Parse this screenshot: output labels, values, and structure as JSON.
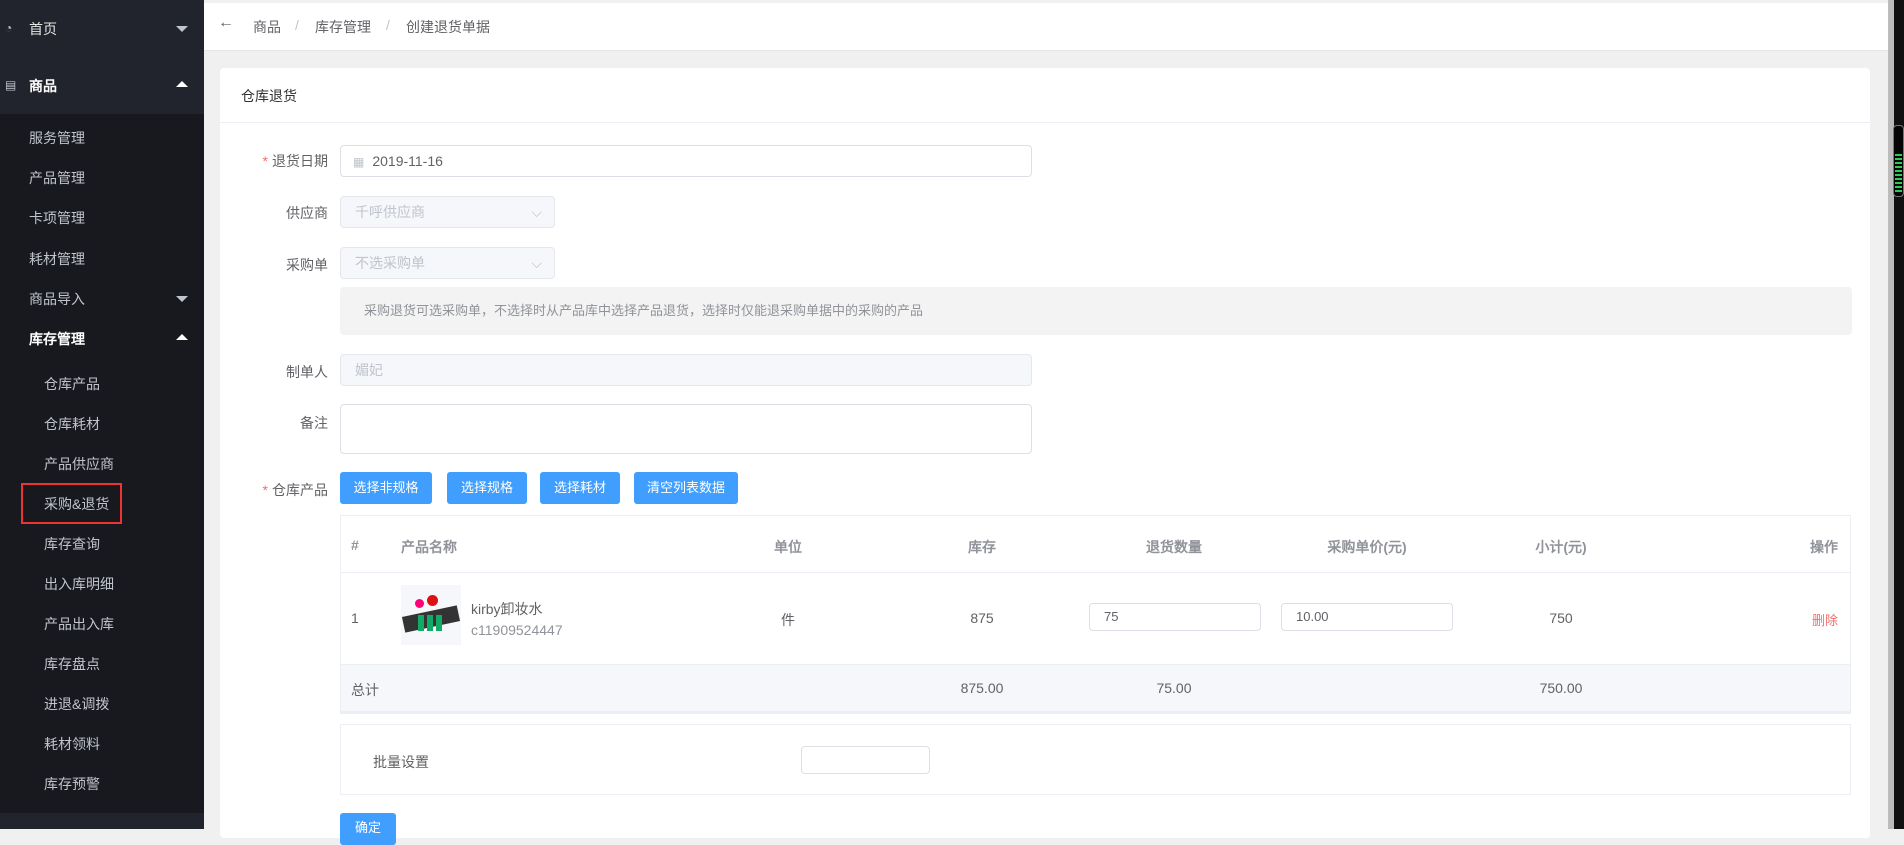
{
  "sidebar": {
    "home": "首页",
    "goods": "商品",
    "items": [
      "服务管理",
      "产品管理",
      "卡项管理",
      "耗材管理",
      "商品导入",
      "库存管理"
    ],
    "sub": [
      "仓库产品",
      "仓库耗材",
      "产品供应商",
      "采购&退货",
      "库存查询",
      "出入库明细",
      "产品出入库",
      "库存盘点",
      "进退&调拨",
      "耗材领料",
      "库存预警"
    ]
  },
  "breadcrumb": [
    "商品",
    "库存管理",
    "创建退货单据"
  ],
  "card": {
    "title": "仓库退货"
  },
  "form": {
    "date_label": "退货日期",
    "date_value": "2019-11-16",
    "supplier_label": "供应商",
    "supplier_value": "千呼供应商",
    "po_label": "采购单",
    "po_value": "不选采购单",
    "tip": "采购退货可选采购单，不选择时从产品库中选择产品退货，选择时仅能退采购单据中的采购的产品",
    "maker_label": "制单人",
    "maker_value": "媚妃",
    "remark_label": "备注",
    "remark_value": "",
    "products_label": "仓库产品",
    "buttons": [
      "选择非规格",
      "选择规格",
      "选择耗材",
      "清空列表数据"
    ]
  },
  "table": {
    "headers": [
      "#",
      "产品名称",
      "单位",
      "库存",
      "退货数量",
      "采购单价(元)",
      "小计(元)",
      "操作"
    ],
    "rows": [
      {
        "index": "1",
        "name": "kirby卸妆水",
        "code": "c11909524447",
        "unit": "件",
        "stock": "875",
        "qty": "75",
        "price": "10.00",
        "subtotal": "750",
        "action": "删除"
      }
    ],
    "total": {
      "label": "总计",
      "stock": "875.00",
      "qty": "75.00",
      "subtotal": "750.00"
    }
  },
  "batch": {
    "label": "批量设置",
    "value": ""
  },
  "confirm": "确定",
  "colors": {
    "primary": "#409eff",
    "danger": "#f56c6c",
    "sidebar": "#18191e"
  }
}
